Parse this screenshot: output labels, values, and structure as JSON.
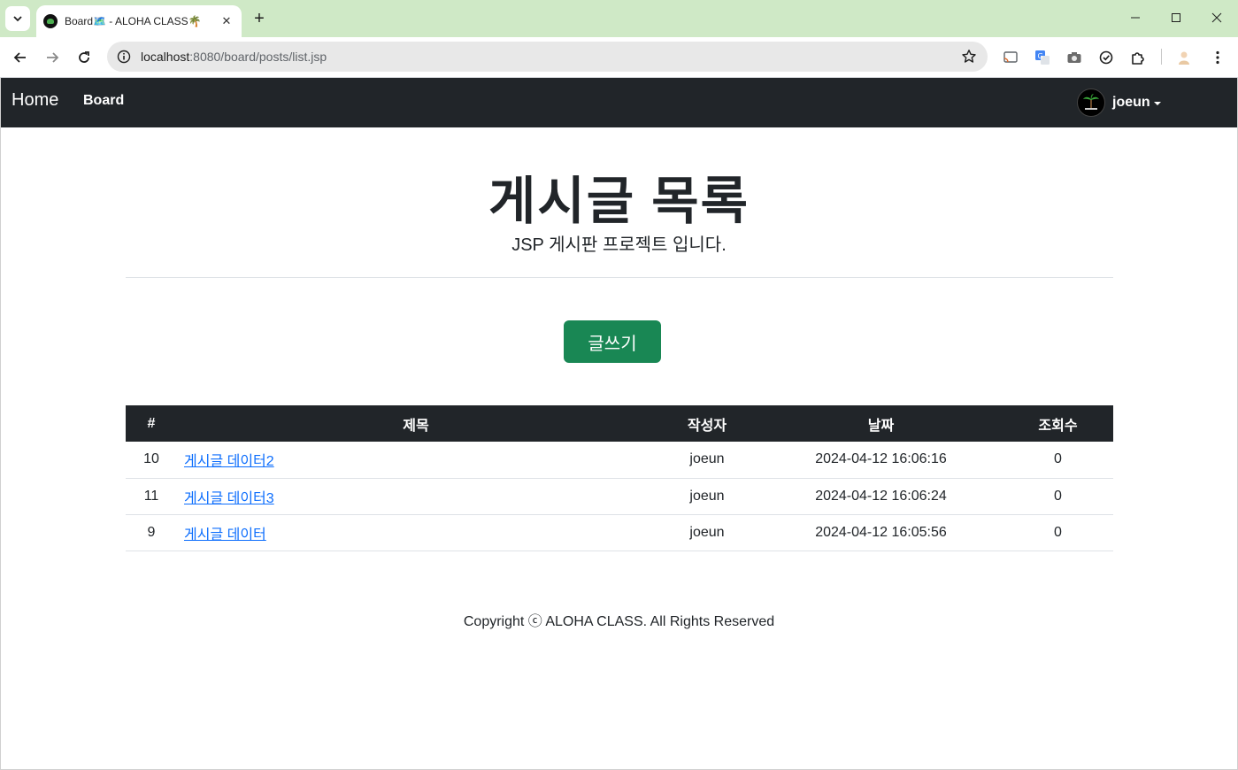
{
  "browser": {
    "tab_title": "Board🗺️ - ALOHA CLASS🌴",
    "url_host": "localhost",
    "url_path": ":8080/board/posts/list.jsp",
    "tab_close": "✕",
    "new_tab": "+"
  },
  "navbar": {
    "brand": "Home",
    "link_board": "Board",
    "user": "joeun"
  },
  "hero": {
    "title": "게시글 목록",
    "subtitle": "JSP 게시판 프로젝트 입니다."
  },
  "write_button": "글쓰기",
  "table": {
    "headers": [
      "#",
      "제목",
      "작성자",
      "날짜",
      "조회수"
    ],
    "rows": [
      {
        "no": "10",
        "title": "게시글 데이터2",
        "writer": "joeun",
        "date": "2024-04-12 16:06:16",
        "views": "0"
      },
      {
        "no": "11",
        "title": "게시글 데이터3",
        "writer": "joeun",
        "date": "2024-04-12 16:06:24",
        "views": "0"
      },
      {
        "no": "9",
        "title": "게시글 데이터",
        "writer": "joeun",
        "date": "2024-04-12 16:05:56",
        "views": "0"
      }
    ]
  },
  "footer": "Copyright ⓒ ALOHA CLASS. All Rights Reserved",
  "colors": {
    "navbar": "#212529",
    "button": "#198754",
    "link": "#0d6efd",
    "tabstrip": "#cfe9c6"
  }
}
